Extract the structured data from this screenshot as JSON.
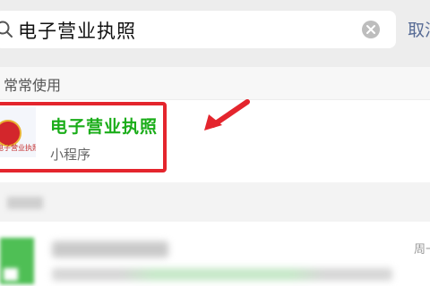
{
  "search": {
    "query": "电子营业执照",
    "cancel_label": "取消"
  },
  "section": {
    "title": "常常使用"
  },
  "result": {
    "name": "电子营业执照",
    "type": "小程序",
    "logo_text": "电子营业执照"
  },
  "blurred_item": {
    "time": "周一"
  },
  "colors": {
    "accent": "#1aad19",
    "highlight": "#e4252d",
    "link": "#576b95"
  }
}
